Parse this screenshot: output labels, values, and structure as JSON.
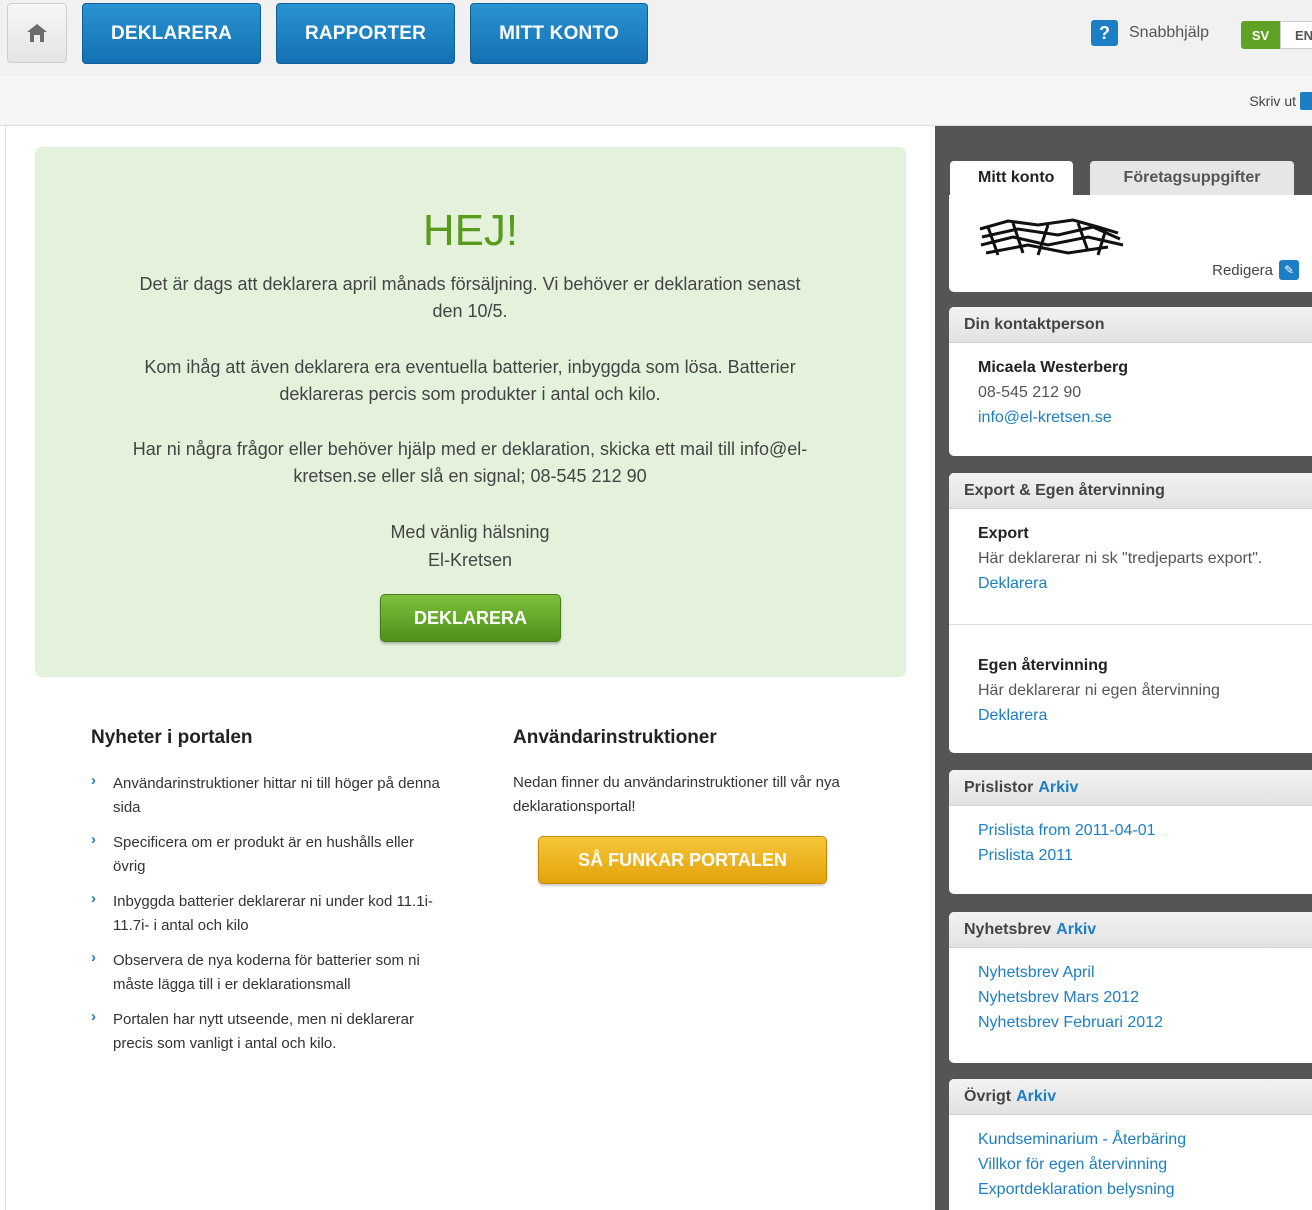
{
  "nav": {
    "items": [
      "DEKLARERA",
      "RAPPORTER",
      "MITT KONTO"
    ],
    "help_label": "Snabbhjälp",
    "help_icon": "?",
    "lang_sv": "SV",
    "lang_en": "EN",
    "print_label": "Skriv ut"
  },
  "welcome": {
    "title": "HEJ!",
    "para1": "Det är dags att deklarera april månads försäljning. Vi behöver er deklaration senast den 10/5.",
    "para2": "Kom ihåg att även deklarera era eventuella batterier, inbyggda som lösa. Batterier deklareras percis som produkter i antal och kilo.",
    "para3": "Har ni några frågor eller behöver hjälp med er deklaration, skicka ett mail till info@el-kretsen.se eller slå en signal; 08-545 212 90",
    "greeting": "Med vänlig hälsning",
    "signature": "El-Kretsen",
    "button": "DEKLARERA"
  },
  "news": {
    "title": "Nyheter i portalen",
    "items": [
      "Användarinstruktioner hittar ni till höger på denna sida",
      "Specificera om er produkt är en hushålls eller övrig",
      "Inbyggda batterier deklarerar ni under kod 11.1i-11.7i- i antal och kilo",
      "Observera de nya koderna för batterier som ni måste lägga till i er deklarationsmall",
      "Portalen har nytt utseende, men ni deklarerar precis som vanligt i antal och kilo."
    ]
  },
  "instructions": {
    "title": "Användarinstruktioner",
    "text": "Nedan finner du användarinstruktioner till vår nya deklarationsportal!",
    "button": "SÅ FUNKAR PORTALEN"
  },
  "sidebar": {
    "tab_active": "Mitt konto",
    "tab_inactive": "Företagsuppgifter",
    "edit_label": "Redigera",
    "contact": {
      "heading": "Din kontaktperson",
      "name": "Micaela Westerberg",
      "phone": "08-545 212 90",
      "email": "info@el-kretsen.se"
    },
    "export": {
      "heading": "Export & Egen återvinning",
      "export_title": "Export",
      "export_text": "Här deklarerar ni sk \"tredjeparts export\".",
      "export_link": "Deklarera",
      "own_title": "Egen återvinning",
      "own_text": "Här deklarerar ni egen återvinning",
      "own_link": "Deklarera"
    },
    "pricelists": {
      "heading": "Prislistor",
      "archive": "Arkiv",
      "links": [
        "Prislista from 2011-04-01",
        "Prislista 2011"
      ]
    },
    "newsletters": {
      "heading": "Nyhetsbrev",
      "archive": "Arkiv",
      "links": [
        "Nyhetsbrev April",
        "Nyhetsbrev Mars 2012",
        "Nyhetsbrev Februari 2012"
      ]
    },
    "other": {
      "heading": "Övrigt",
      "archive": "Arkiv",
      "links": [
        "Kundseminarium - Återbäring",
        "Villkor för egen återvinning",
        "Exportdeklaration belysning"
      ]
    }
  }
}
